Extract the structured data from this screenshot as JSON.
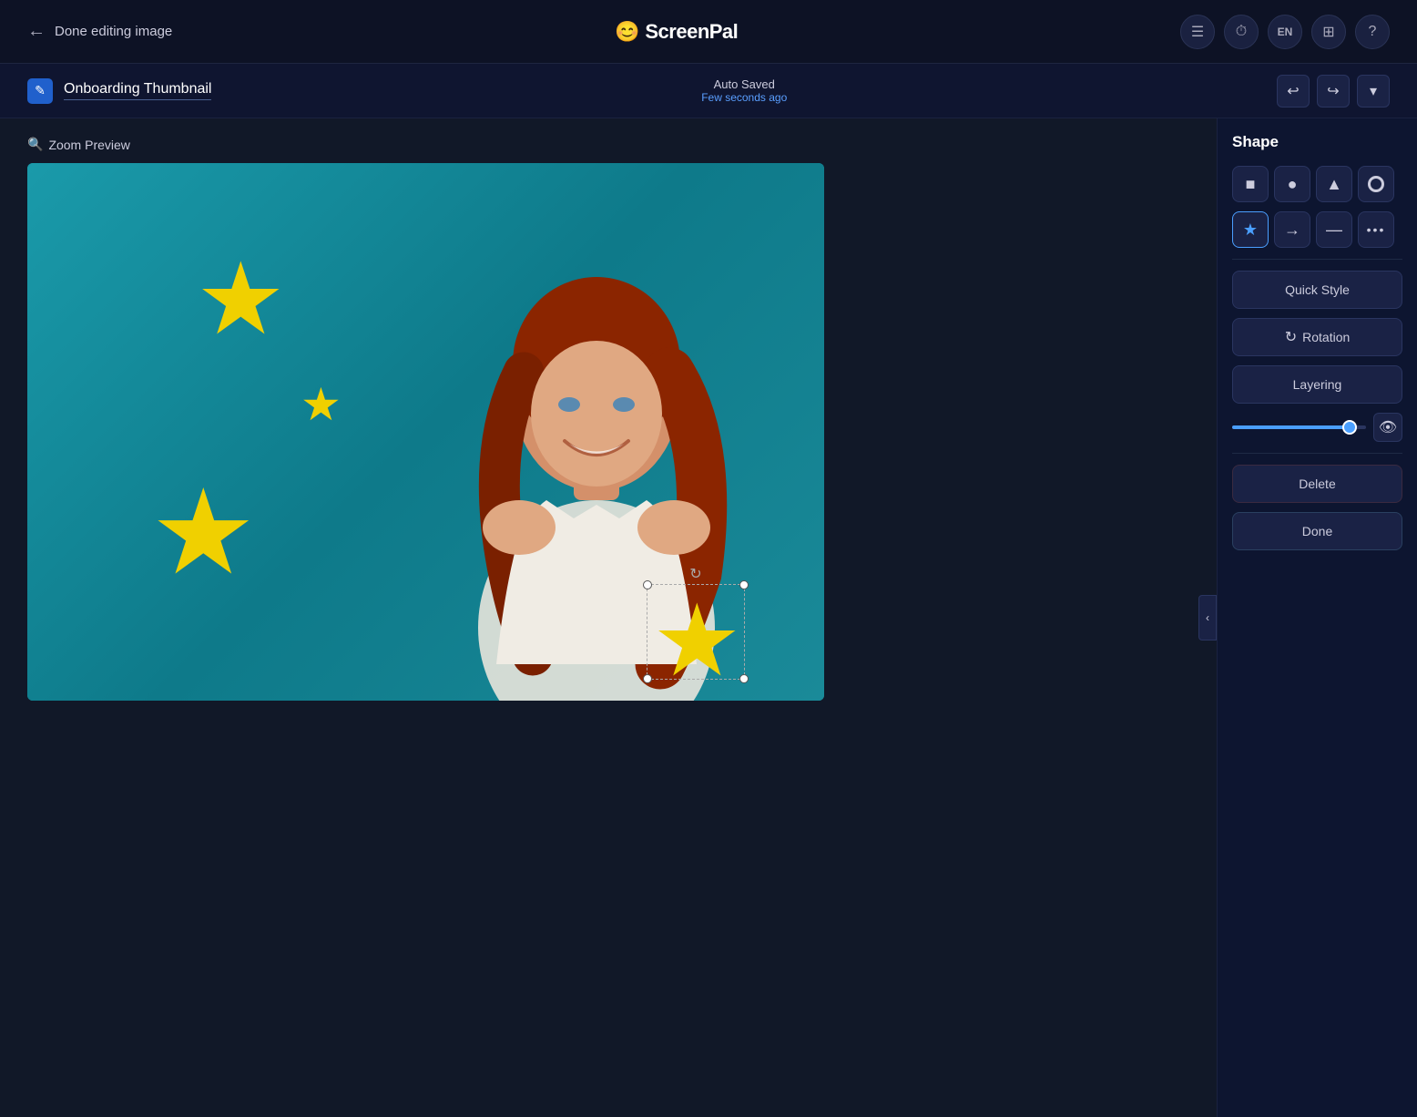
{
  "nav": {
    "back_label": "Done editing image",
    "logo": "ScreenPal",
    "icons": {
      "menu": "☰",
      "history": "⏱",
      "lang": "EN",
      "layers": "⊕",
      "help": "?"
    }
  },
  "toolbar": {
    "file_icon": "✎",
    "file_title": "Onboarding Thumbnail",
    "auto_saved_label": "Auto Saved",
    "save_time": "Few seconds ago",
    "undo_icon": "↩",
    "redo_icon": "↪",
    "dropdown_icon": "▾"
  },
  "canvas": {
    "zoom_preview_label": "Zoom Preview"
  },
  "shape_panel": {
    "title": "Shape",
    "shapes_row1": [
      {
        "id": "rect",
        "symbol": "■"
      },
      {
        "id": "circle",
        "symbol": "●"
      },
      {
        "id": "triangle",
        "symbol": "▲"
      },
      {
        "id": "circle-outline",
        "symbol": "◎"
      }
    ],
    "shapes_row2": [
      {
        "id": "star",
        "symbol": "★",
        "active": true
      },
      {
        "id": "arrow",
        "symbol": "→"
      },
      {
        "id": "line",
        "symbol": "—"
      },
      {
        "id": "more",
        "symbol": "•••"
      }
    ],
    "quick_style_label": "Quick Style",
    "rotation_label": "Rotation",
    "rotation_icon": "↻",
    "layering_label": "Layering",
    "opacity_value": 85,
    "eye_icon": "👁",
    "delete_label": "Delete",
    "done_label": "Done"
  }
}
